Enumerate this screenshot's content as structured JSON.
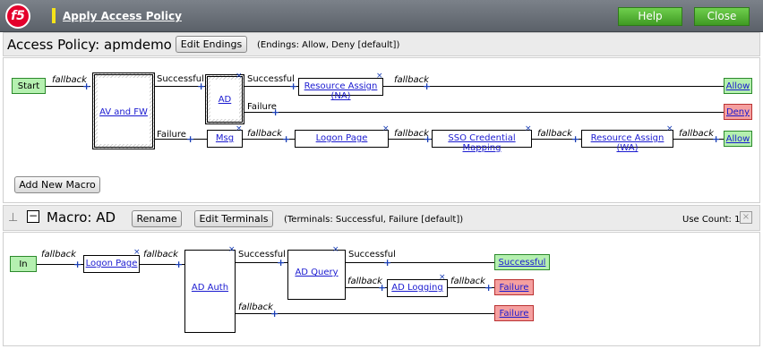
{
  "header": {
    "logo_text": "f5",
    "title": "Apply Access Policy",
    "help_label": "Help",
    "close_label": "Close"
  },
  "policy": {
    "title": "Access Policy: apmdemo",
    "edit_endings_label": "Edit Endings",
    "endings_text": "(Endings: Allow, Deny [default])",
    "start_label": "Start",
    "fallback": "fallback",
    "successful": "Successful",
    "failure": "Failure",
    "nodes": {
      "av_fw": "AV and FW",
      "ad": "AD",
      "resource_assign_na": "Resource Assign (NA)",
      "msg": "Msg",
      "logon_page": "Logon Page",
      "sso": "SSO Credential Mapping",
      "resource_assign_wa": "Resource Assign (WA)"
    },
    "endings": {
      "allow1": "Allow",
      "deny": "Deny",
      "allow2": "Allow"
    },
    "add_macro_label": "Add New Macro"
  },
  "macro": {
    "title": "Macro: AD",
    "rename_label": "Rename",
    "edit_terminals_label": "Edit Terminals",
    "terminals_text": "(Terminals: Successful, Failure [default])",
    "use_count_text": "Use Count: 1",
    "in_label": "In",
    "nodes": {
      "logon_page": "Logon Page",
      "ad_auth": "AD Auth",
      "ad_query": "AD Query",
      "ad_logging": "AD Logging"
    },
    "terminals": {
      "successful": "Successful",
      "failure1": "Failure",
      "failure2": "Failure"
    }
  },
  "colors": {
    "topbar": "#6b7179",
    "green_button": "#4fb12f",
    "allow_fill": "#b5f0b0",
    "deny_fill": "#f5a0a0",
    "link": "#1a1ad0"
  }
}
